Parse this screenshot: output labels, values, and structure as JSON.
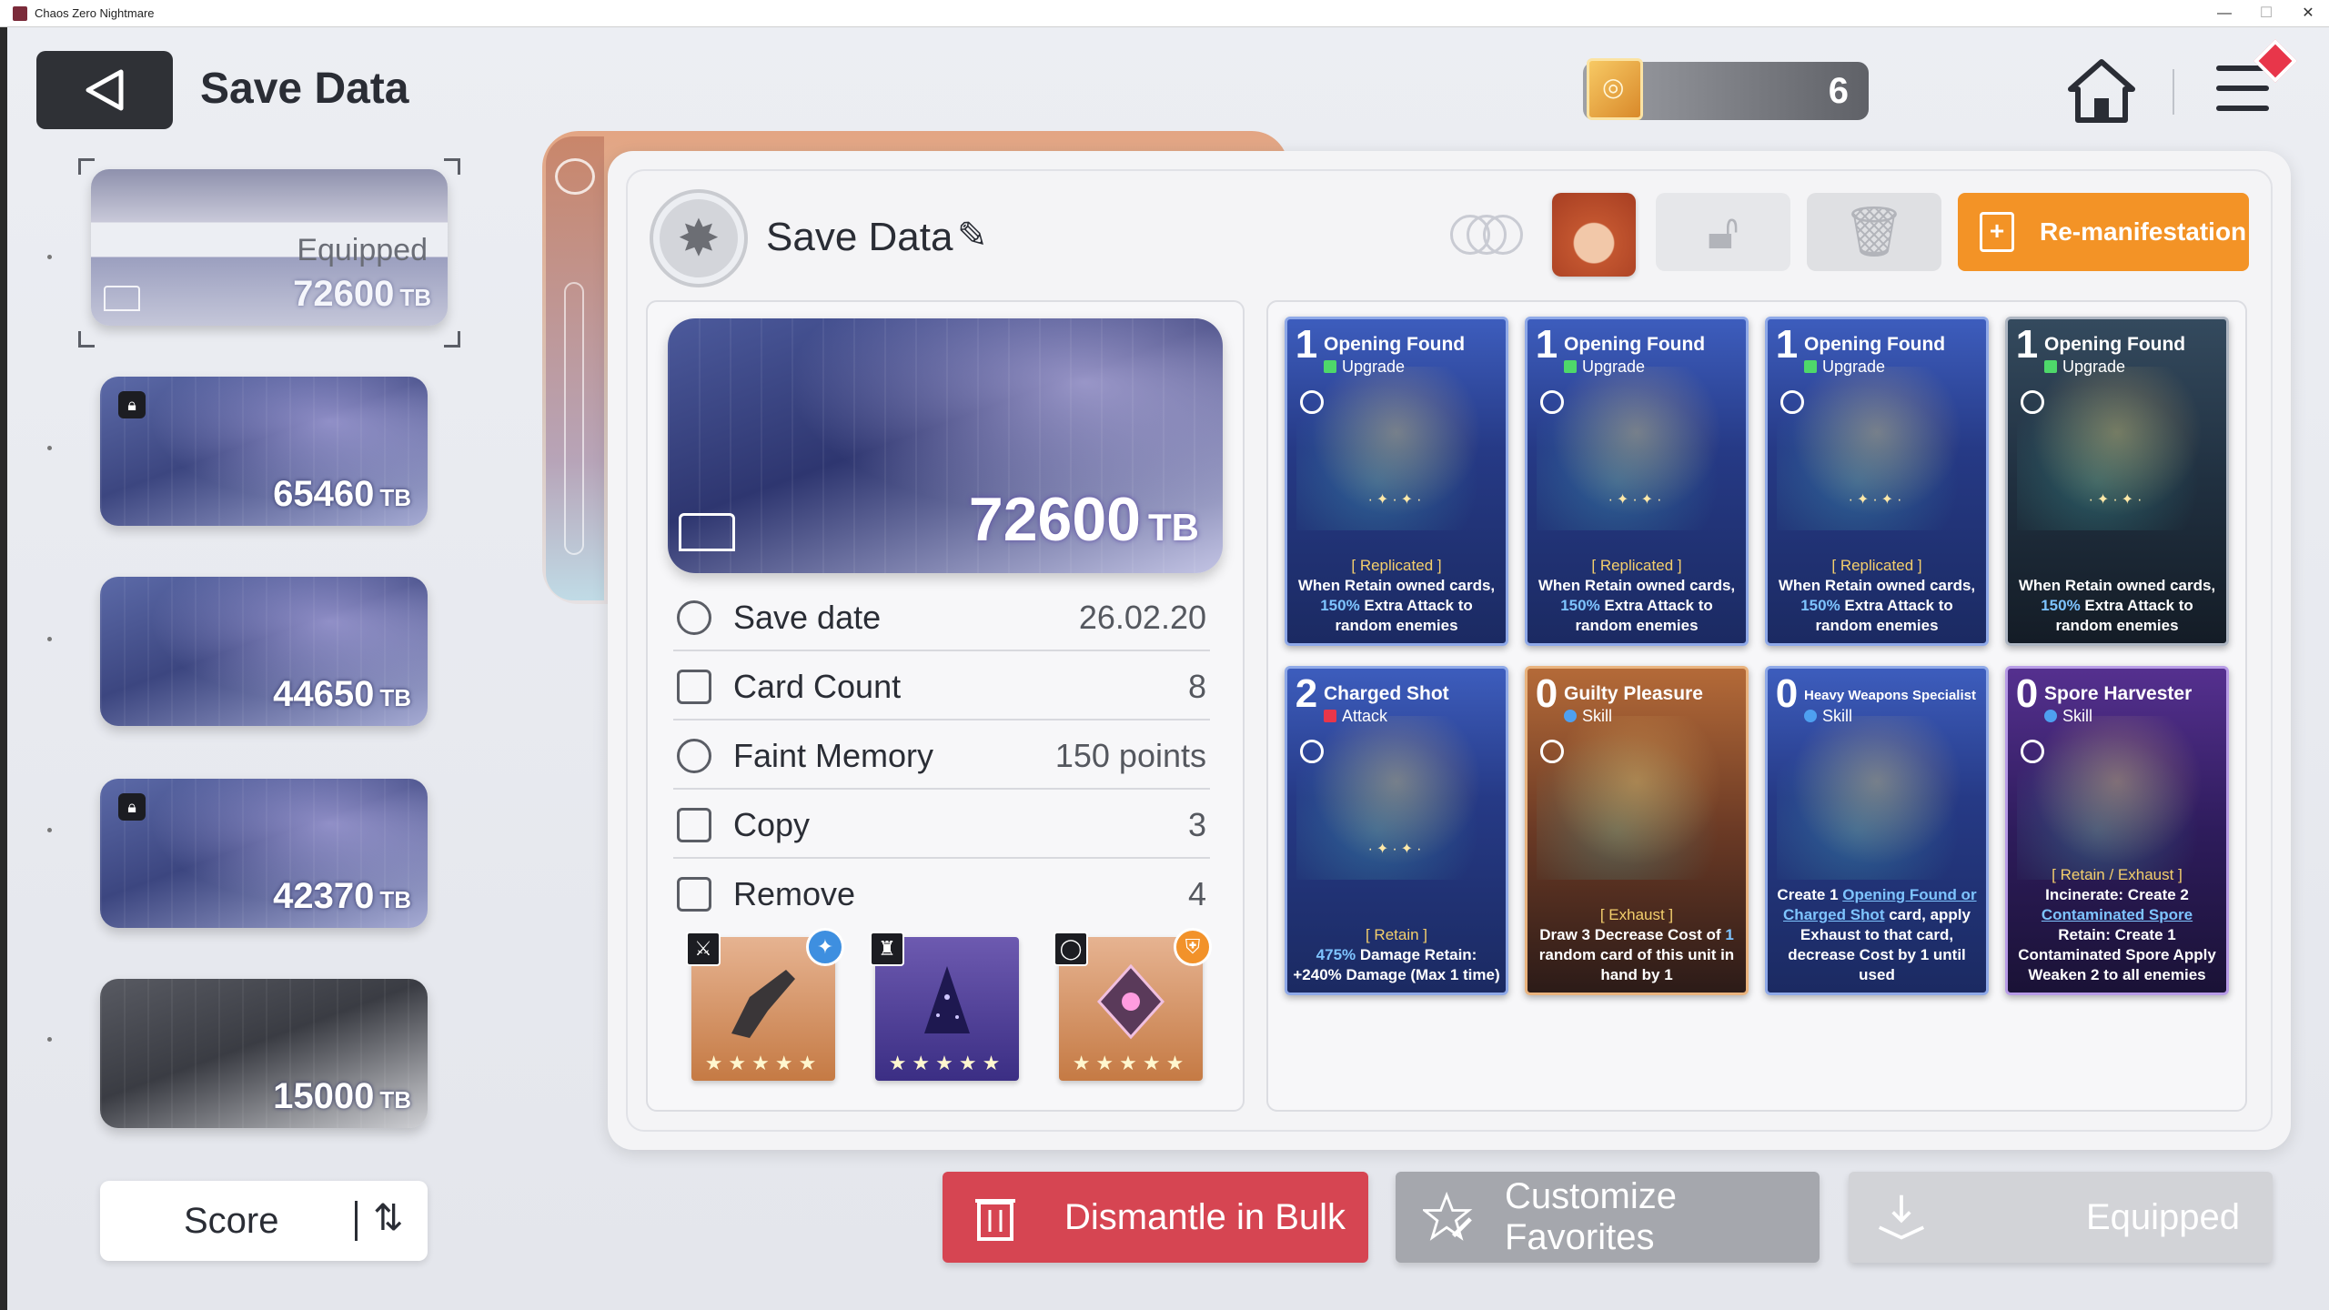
{
  "window": {
    "title": "Chaos Zero Nightmare",
    "controls": [
      "—",
      "☐",
      "✕"
    ]
  },
  "header": {
    "title": "Save Data",
    "tb_count": "6"
  },
  "slots": [
    {
      "value": "72600",
      "unit": "TB",
      "status": "Equipped",
      "locked": false,
      "selected": true
    },
    {
      "value": "65460",
      "unit": "TB",
      "locked": true
    },
    {
      "value": "44650",
      "unit": "TB",
      "locked": false
    },
    {
      "value": "42370",
      "unit": "TB",
      "locked": true
    },
    {
      "value": "15000",
      "unit": "TB",
      "locked": false
    }
  ],
  "sort": {
    "label": "Score",
    "icon": "sort-icon"
  },
  "deck": {
    "name": "Save Data",
    "value": "72600",
    "unit": "TB",
    "action_label": "Re-manifestation",
    "stats": [
      {
        "label": "Save date",
        "value": "26.02.20",
        "icon": "clock-icon"
      },
      {
        "label": "Card Count",
        "value": "8",
        "icon": "card-icon"
      },
      {
        "label": "Faint Memory",
        "value": "150 points",
        "icon": "brain-icon"
      },
      {
        "label": "Copy",
        "value": "3",
        "icon": "copy-icon"
      },
      {
        "label": "Remove",
        "value": "4",
        "icon": "remove-icon"
      }
    ],
    "equipment": [
      {
        "slot": "weapon",
        "stars": "★★★★★"
      },
      {
        "slot": "armor",
        "stars": "★★★★★"
      },
      {
        "slot": "accessory",
        "stars": "★★★★★"
      }
    ]
  },
  "cards": [
    {
      "cost": "1",
      "name": "Opening Found",
      "type": "Upgrade",
      "tag": "[ Replicated ]",
      "desc_a": "When Retain owned cards, ",
      "desc_hl": "150%",
      "desc_b": " Extra Attack to random enemies"
    },
    {
      "cost": "1",
      "name": "Opening Found",
      "type": "Upgrade",
      "tag": "[ Replicated ]",
      "desc_a": "When Retain owned cards, ",
      "desc_hl": "150%",
      "desc_b": " Extra Attack to random enemies"
    },
    {
      "cost": "1",
      "name": "Opening Found",
      "type": "Upgrade",
      "tag": "[ Replicated ]",
      "desc_a": "When Retain owned cards, ",
      "desc_hl": "150%",
      "desc_b": " Extra Attack to random enemies"
    },
    {
      "cost": "1",
      "name": "Opening Found",
      "type": "Upgrade",
      "tag": "",
      "desc_a": "When Retain owned cards, ",
      "desc_hl": "150%",
      "desc_b": " Extra Attack to random enemies"
    },
    {
      "cost": "2",
      "name": "Charged Shot",
      "type": "Attack",
      "tag": "[ Retain ]",
      "desc_a": "",
      "desc_hl": "475%",
      "desc_b": " Damage Retain: +240% Damage (Max 1 time)"
    },
    {
      "cost": "0",
      "name": "Guilty Pleasure",
      "type": "Skill",
      "tag": "[ Exhaust ]",
      "desc_a": "Draw 3 Decrease Cost of ",
      "desc_hl": "1",
      "desc_b": " random card of this unit in hand by 1"
    },
    {
      "cost": "0",
      "name": "Heavy Weapons Specialist",
      "type": "Skill",
      "tag": "",
      "desc_a": "Create 1 ",
      "desc_hl": "Opening Found or Charged Shot",
      "desc_b": " card, apply Exhaust to that card, decrease Cost by 1 until used"
    },
    {
      "cost": "0",
      "name": "Spore Harvester",
      "type": "Skill",
      "tag": "[ Retain / Exhaust ]",
      "desc_a": "Incinerate: Create 2 ",
      "desc_hl": "Contaminated Spore",
      "desc_b": " Retain: Create 1 Contaminated Spore Apply Weaken 2 to all enemies"
    }
  ],
  "bottom": {
    "dismantle": "Dismantle in Bulk",
    "favorites": "Customize Favorites",
    "equipped": "Equipped"
  }
}
